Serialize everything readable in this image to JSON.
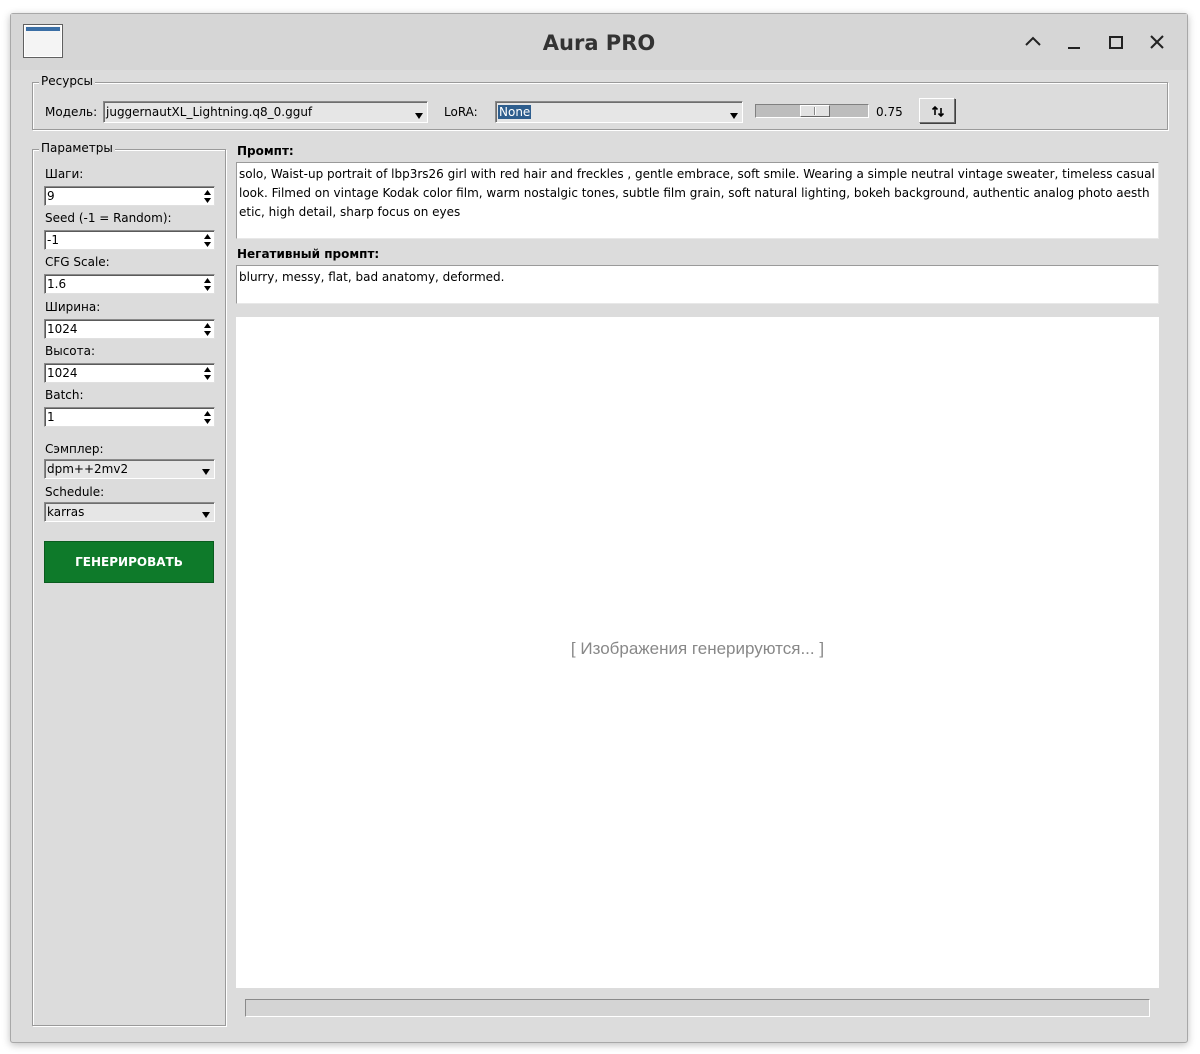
{
  "window": {
    "title": "Aura PRO",
    "controls": [
      "chevron-up-icon",
      "minimize-icon",
      "maximize-icon",
      "close-icon"
    ]
  },
  "resources": {
    "legend": "Ресурсы",
    "model_label": "Модель:",
    "model_value": "juggernautXL_Lightning.q8_0.gguf",
    "lora_label": "LoRA:",
    "lora_value": "None",
    "lora_strength": 0.75,
    "lora_strength_text": "0.75",
    "refresh_icon": "refresh-icon"
  },
  "params": {
    "legend": "Параметры",
    "steps_label": "Шаги:",
    "steps_value": "9",
    "seed_label": "Seed (-1 = Random):",
    "seed_value": "-1",
    "cfg_label": "CFG Scale:",
    "cfg_value": "1.6",
    "width_label": "Ширина:",
    "width_value": "1024",
    "height_label": "Высота:",
    "height_value": "1024",
    "batch_label": "Batch:",
    "batch_value": "1",
    "sampler_label": "Сэмплер:",
    "sampler_value": "dpm++2mv2",
    "schedule_label": "Schedule:",
    "schedule_value": "karras",
    "generate_label": "ГЕНЕРИРОВАТЬ"
  },
  "prompt": {
    "label": "Промпт:",
    "value": "solo, Waist-up portrait of lbp3rs26 girl with red hair and freckles , gentle embrace, soft smile. Wearing a simple neutral vintage sweater, timeless casual look. Filmed on vintage Kodak color film, warm nostalgic tones, subtle film grain, soft natural lighting, bokeh background, authentic analog photo aesthetic, high detail, sharp focus on eyes"
  },
  "negative_prompt": {
    "label": "Негативный промпт:",
    "value": "blurry, messy, flat, bad anatomy, deformed."
  },
  "output": {
    "placeholder": "[ Изображения генерируются... ]"
  },
  "progress": {
    "value": 0
  },
  "colors": {
    "generate_button": "#0e7a2a",
    "window_bg": "#dcdcdc",
    "selection": "#2e5e8e"
  }
}
